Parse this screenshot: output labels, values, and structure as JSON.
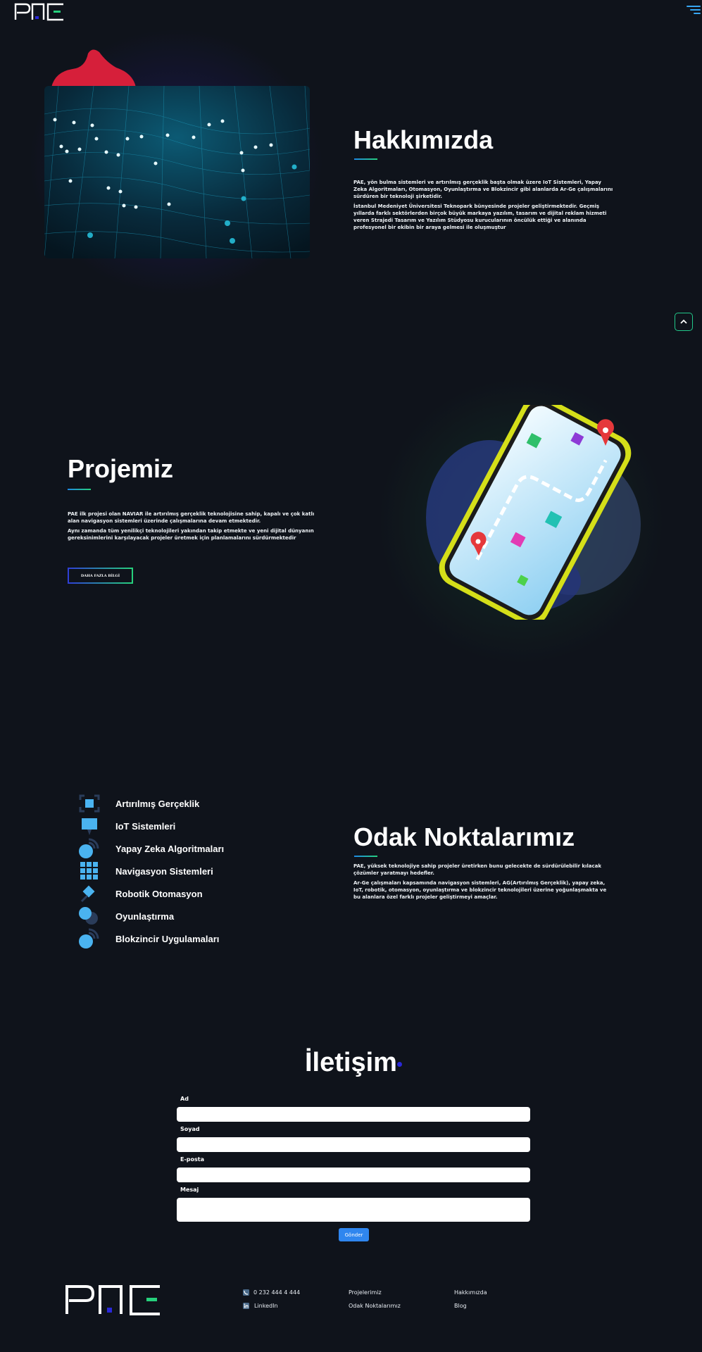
{
  "header": {
    "logo_alt": "PAE",
    "menu_icon": "hamburger-menu-icon"
  },
  "about": {
    "title": "Hakkımızda",
    "paragraphs": [
      "PAE, yön bulma sistemleri ve artırılmış gerçeklik başta olmak üzere IoT Sistemleri, Yapay Zeka Algoritmaları, Otomasyon, Oyunlaştırma ve Blokzincir gibi alanlarda Ar-Ge çalışmalarını sürdüren bir teknoloji şirketidir.",
      "İstanbul Medeniyet Üniversitesi Teknopark bünyesinde projeler geliştirmektedir. Geçmiş yıllarda farklı sektörlerden birçok büyük markaya yazılım, tasarım ve dijital reklam hizmeti veren Strajedi Tasarım ve Yazılım Stüdyosu kurucularının öncülük ettiği ve alanında profesyonel bir ekibin bir araya gelmesi ile oluşmuştur"
    ]
  },
  "project": {
    "title": "Projemiz",
    "paragraphs": [
      "PAE ilk projesi olan NAVIAR ile artırılmış gerçeklik teknolojisine sahip, kapalı ve çok katlı alan navigasyon sistemleri üzerinde çalışmalarına devam etmektedir.",
      "Aynı zamanda tüm yenilikçi teknolojileri yakından takip etmekte ve yeni dijital dünyanın gereksinimlerini karşılayacak projeler üretmek için planlamalarını sürdürmektedir"
    ],
    "button_label": "DAHA FAZLA BİLGİ"
  },
  "focus": {
    "title": "Odak Noktalarımız",
    "items": [
      {
        "label": "Artırılmış Gerçeklik",
        "icon": "ar-icon"
      },
      {
        "label": "IoT Sistemleri",
        "icon": "iot-icon"
      },
      {
        "label": "Yapay Zeka Algoritmaları",
        "icon": "ai-icon"
      },
      {
        "label": "Navigasyon Sistemleri",
        "icon": "navigation-grid-icon"
      },
      {
        "label": "Robotik Otomasyon",
        "icon": "robotics-icon"
      },
      {
        "label": "Oyunlaştırma",
        "icon": "gamification-icon"
      },
      {
        "label": "Blokzincir Uygulamaları",
        "icon": "blockchain-icon"
      }
    ],
    "paragraphs": [
      "PAE, yüksek teknolojiye sahip projeler üretirken bunu gelecekte de sürdürülebilir kılacak çözümler yaratmayı hedefler.",
      "Ar-Ge çalışmaları kapsamında navigasyon sistemleri, AG(Artırılmış Gerçeklik), yapay zeka, IoT, robotik, otomasyon, oyunlaştırma ve blokzincir teknolojileri üzerine yoğunlaşmakta ve bu alanlara özel farklı projeler geliştirmeyi amaçlar."
    ]
  },
  "contact": {
    "title": "İletişim",
    "fields": {
      "first_name": {
        "label": "Ad",
        "value": ""
      },
      "last_name": {
        "label": "Soyad",
        "value": ""
      },
      "email": {
        "label": "E-posta",
        "value": ""
      },
      "message": {
        "label": "Mesaj",
        "value": ""
      }
    },
    "submit_label": "Gönder"
  },
  "footer": {
    "logo_alt": "PAE",
    "phone": "0 232 444 4 444",
    "linkedin": "LinkedIn",
    "links": [
      "Projelerimiz",
      "Odak Noktalarımız",
      "Hakkımızda",
      "Blog"
    ]
  },
  "colors": {
    "background": "#0f131b",
    "accent_blue": "#2f86ef",
    "accent_green": "#26d07c",
    "blob_red": "#d61f3a"
  }
}
